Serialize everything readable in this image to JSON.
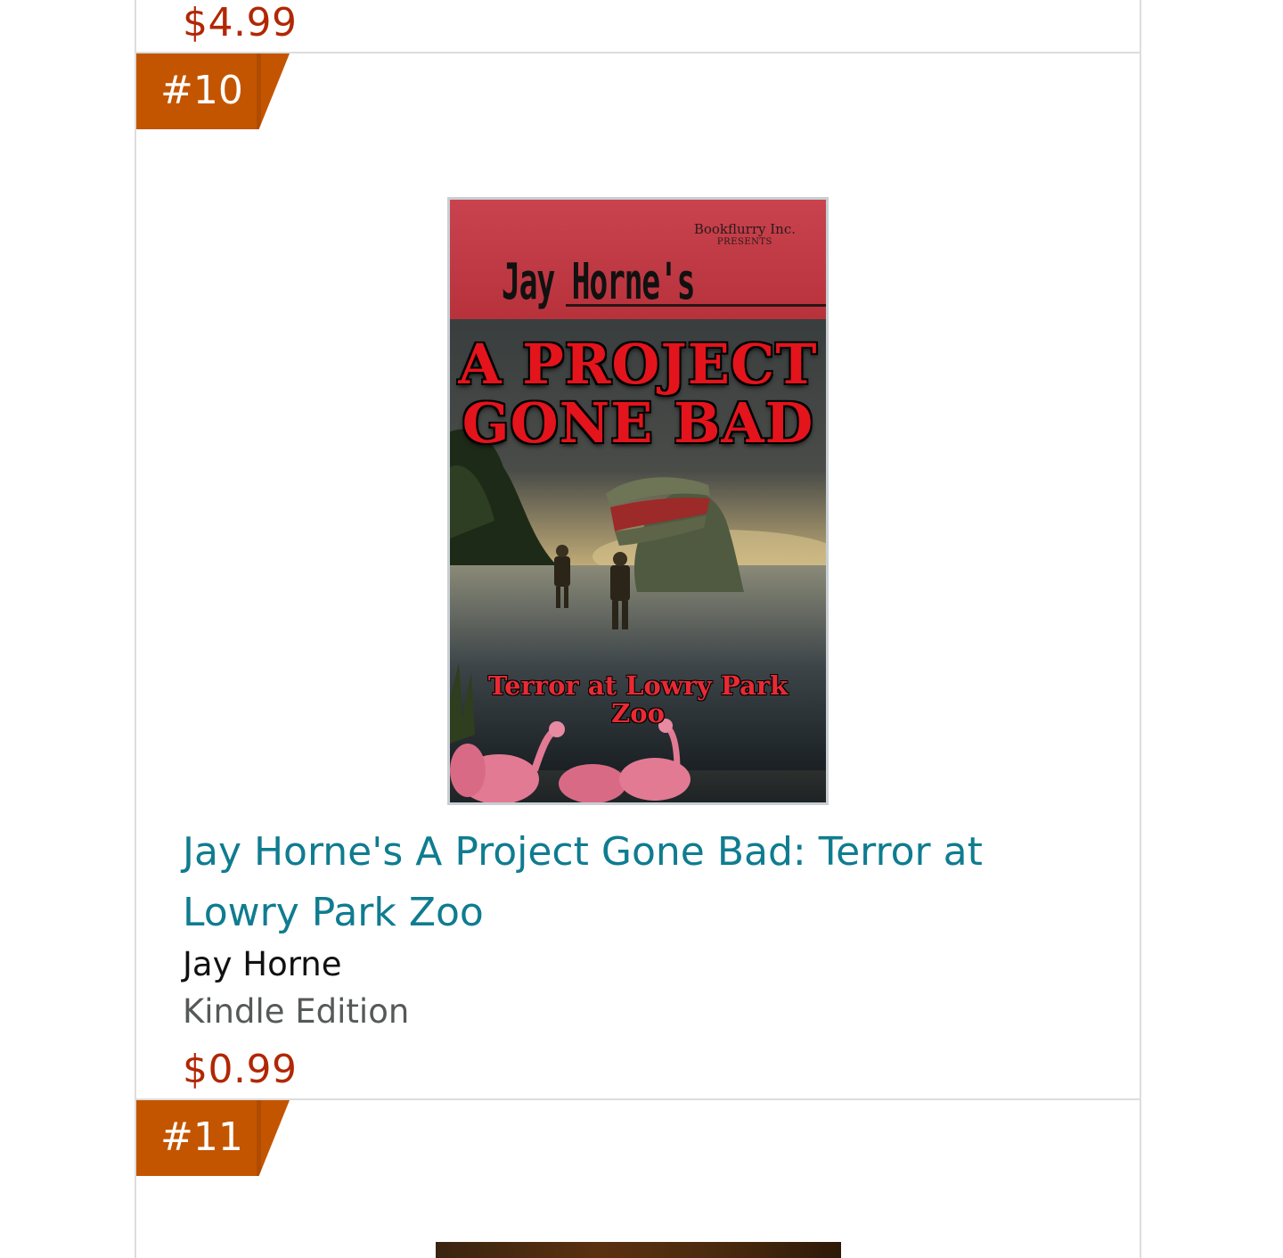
{
  "previous_item": {
    "price": "$4.99"
  },
  "item": {
    "rank": "#10",
    "cover": {
      "publisher": "Bookflurry Inc.",
      "publisher_sub": "PRESENTS",
      "author_line": "Jay Horne's",
      "title_line_1": "A PROJECT",
      "title_line_2": "GONE BAD",
      "subtitle_line_1": "Terror at Lowry Park",
      "subtitle_line_2": "Zoo"
    },
    "title": "Jay Horne's A Project Gone Bad: Terror at Lowry Park Zoo",
    "author": "Jay Horne",
    "format": "Kindle Edition",
    "price": "$0.99"
  },
  "next_item": {
    "rank": "#11"
  },
  "colors": {
    "badge": "#c45500",
    "link": "#0f7c90",
    "price": "#b12704",
    "format": "#565959",
    "border": "#dddddd"
  }
}
